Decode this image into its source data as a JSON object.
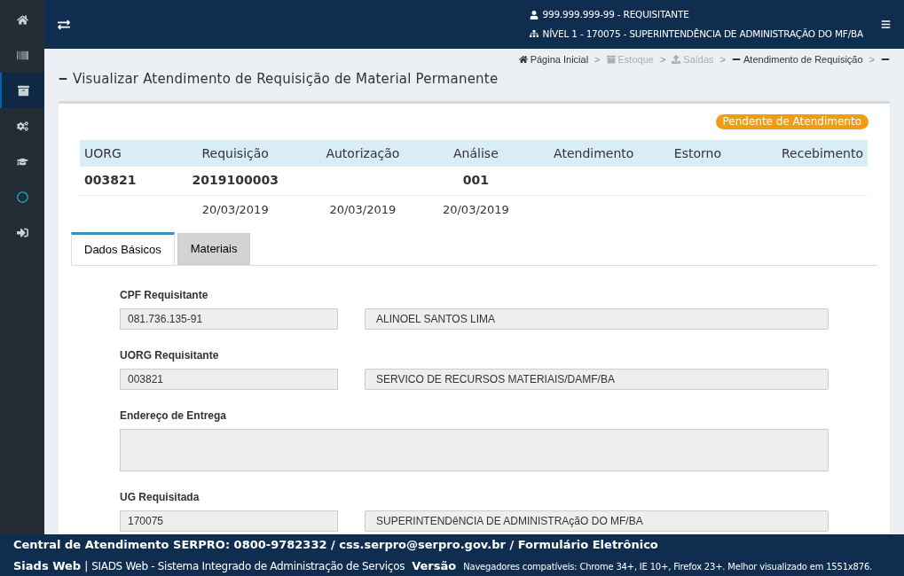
{
  "sidebar": {
    "items": [
      {
        "selected": false
      },
      {
        "selected": false
      },
      {
        "selected": true
      },
      {
        "selected": false
      },
      {
        "selected": false
      },
      {
        "selected": false
      },
      {
        "selected": false
      }
    ]
  },
  "header": {
    "user": "999.999.999-99 - REQUISITANTE",
    "unit": "NÍVEL 1 - 170075 - SUPERINTENDÊNCIA DE ADMINISTRAÇÃO DO MF/BA"
  },
  "breadcrumb": [
    {
      "label": "Página Inicial",
      "disabled": false
    },
    {
      "separator": ">",
      "label": "Estoque",
      "disabled": true
    },
    {
      "separator": ">",
      "label": "Saídas",
      "disabled": true
    },
    {
      "separator": ">",
      "label": "Atendimento de Requisição",
      "disabled": false
    },
    {
      "separator": ">",
      "disabled": false
    }
  ],
  "page_title": "Visualizar Atendimento de Requisição de Material Permanente",
  "status_badge": "Pendente de Atendimento",
  "table": {
    "columns": [
      "UORG",
      "Requisição",
      "Autorização",
      "Análise",
      "Atendimento",
      "Estorno",
      "Recebimento"
    ],
    "rows": [
      [
        "003821",
        "2019100003",
        "",
        "001",
        "",
        "",
        ""
      ],
      [
        "",
        "20/03/2019",
        "20/03/2019",
        "20/03/2019",
        "",
        "",
        ""
      ]
    ]
  },
  "tabs": [
    {
      "label": "Dados Básicos",
      "selected": true
    },
    {
      "label": "Materiais",
      "selected": false
    }
  ],
  "fields": [
    {
      "kind": "pair",
      "label": "CPF Requisitante",
      "code": "081.736.135-91",
      "name": "ALINOEL SANTOS LIMA"
    },
    {
      "kind": "pair",
      "label": "UORG Requisitante",
      "code": "003821",
      "name": "SERVICO DE RECURSOS MATERIAIS/DAMF/BA"
    },
    {
      "kind": "textarea",
      "label": "Endereço de Entrega"
    },
    {
      "kind": "pair",
      "label": "UG Requisitada",
      "code": "170075",
      "name": "SUPERINTENDêNCIA DE ADMINISTRAçãO DO MF/BA"
    }
  ],
  "footer": {
    "contact": "Central de Atendimento SERPRO: 0800-9782332 / css.serpro@serpro.gov.br / Formulário Eletrônico",
    "app_name": "Siads Web",
    "separator": "|",
    "app_full_name": "SIADS Web - Sistema Integrado de Administração de Serviços",
    "version_label": "Versão",
    "browsers_note": "Navegadores compatíveis: Chrome 34+, IE 10+, Firefox 23+. Melhor visualizado em 1551x876."
  }
}
